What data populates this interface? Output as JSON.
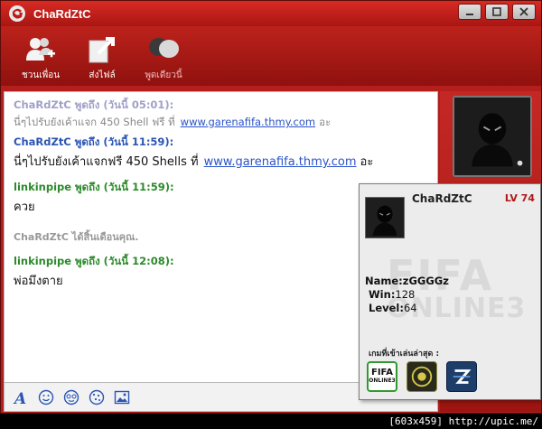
{
  "window": {
    "title": "ChaRdZtC"
  },
  "toolbar": {
    "items": [
      {
        "label": "ชวนเพื่อน",
        "icon": "add-user-icon"
      },
      {
        "label": "ส่งไฟล์",
        "icon": "send-file-icon"
      },
      {
        "label": "พูดเดียวนี้",
        "icon": "voice-chat-icon"
      }
    ]
  },
  "chat": {
    "messages": [
      {
        "header": "ChaRdZtC พูดถึง (วันนี้ 05:01):",
        "text": "นี่ๆไปรับยังเค้าแจก 450  Shell ฟรี ที่",
        "link": "www.garenafifa.thmy.com",
        "suffix": "อะ"
      },
      {
        "header": "ChaRdZtC พูดถึง (วันนี้ 11:59):",
        "text": "นี่ๆไปรับยังเค้าแจกฟรี 450 Shells ที่",
        "link": "www.garenafifa.thmy.com",
        "suffix": "อะ"
      },
      {
        "header": "linkinpipe พูดถึง (วันนี้ 11:59):",
        "text": "ควย"
      },
      {
        "system": "ChaRdZtC ได้สิ้นเดือนคุณ."
      },
      {
        "header": "linkinpipe พูดถึง (วันนี้ 12:08):",
        "text": "พ่อมึงตาย"
      }
    ]
  },
  "profile": {
    "name": "ChaRdZtC",
    "level": "LV 74",
    "name_label": "Name:",
    "name_value": "zGGGGz",
    "win_label": "Win:",
    "win_value": "128",
    "level_label": "Level:",
    "level_value": "64",
    "recent_games_label": "เกมที่เข้าเล่นล่าสุด :",
    "watermark_line1": "FIFA",
    "watermark_line2": "ONLINE3",
    "games": [
      {
        "name": "FIFA ONLINE 3",
        "icon": "fifa-online-3-icon"
      },
      {
        "name": "HoN",
        "icon": "hon-icon"
      },
      {
        "name": "PB",
        "icon": "point-blank-icon"
      }
    ]
  },
  "footer": {
    "text": "[603x459] http://upic.me/"
  },
  "colors": {
    "brand_red": "#b41e1c",
    "link_blue": "#2a54c8",
    "name_blue": "#2a55b5",
    "name_green": "#2c8a2c"
  }
}
